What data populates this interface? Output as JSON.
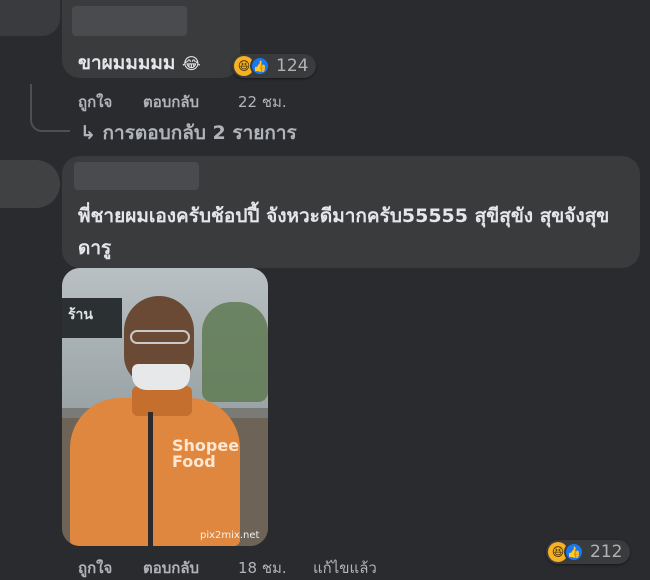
{
  "comment1": {
    "text": "ขาผมมมมม",
    "emoji": "😂",
    "reaction_count": "124",
    "like_label": "ถูกใจ",
    "reply_label": "ตอบกลับ",
    "time": "22 ชม.",
    "replies_link": "↳ การตอบกลับ 2 รายการ"
  },
  "comment2": {
    "text": "พี่ชายผมเองครับช้อปปี้ จังหวะดีมากครับ55555",
    "mention": "สุขีสุขัง สุขจังสุขดารู",
    "reaction_count": "212",
    "like_label": "ถูกใจ",
    "reply_label": "ตอบกลับ",
    "time": "18 ชม.",
    "edited_label": "แก้ไขแล้ว",
    "photo": {
      "store_sign": "ร้าน",
      "jacket_logo_line1": "Shopee",
      "jacket_logo_line2": "Food",
      "watermark": "pix2mix.net"
    }
  },
  "colors": {
    "background": "#2a2b2e",
    "bubble": "#3a3b3c",
    "text": "#e4e6eb",
    "muted": "#b0b3b8",
    "like_blue": "#1877f2",
    "haha_yellow": "#f7b125"
  },
  "icons": [
    "haha-reaction-icon",
    "like-reaction-icon",
    "reply-arrow-icon"
  ]
}
